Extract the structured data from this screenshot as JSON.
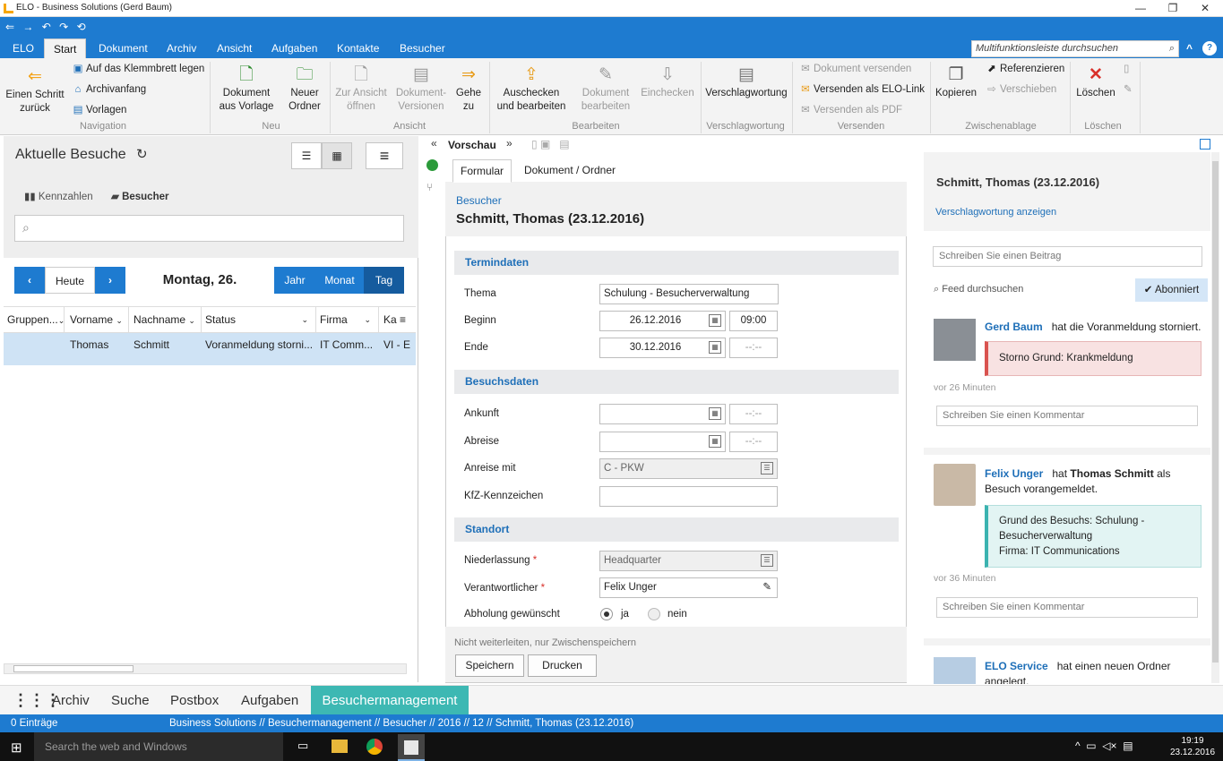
{
  "window": {
    "title": "ELO - Business Solutions (Gerd Baum)",
    "minimize": "—",
    "restore": "❐",
    "close": "✕"
  },
  "quickaccess": [
    "⇐",
    "→",
    "↶",
    "↷",
    "⟲"
  ],
  "menu": {
    "tabs": [
      "ELO",
      "Start",
      "Dokument",
      "Archiv",
      "Ansicht",
      "Aufgaben",
      "Kontakte",
      "Besucher"
    ],
    "active": "Start",
    "search_placeholder": "Multifunktionsleiste durchsuchen",
    "up": "^",
    "help": "?"
  },
  "ribbon": {
    "nav_back": "Einen Schritt zurück",
    "nav_back_l1": "Einen Schritt",
    "nav_back_l2": "zurück",
    "clipboard": "Auf das Klemmbrett legen",
    "archive_start": "Archivanfang",
    "templates": "Vorlagen",
    "group_nav": "Navigation",
    "doc_from_template_l1": "Dokument",
    "doc_from_template_l2": "aus Vorlage",
    "new_folder_l1": "Neuer",
    "new_folder_l2": "Ordner",
    "group_new": "Neu",
    "open_view_l1": "Zur Ansicht",
    "open_view_l2": "öffnen",
    "doc_versions_l1": "Dokument-",
    "doc_versions_l2": "Versionen",
    "goto_l1": "Gehe",
    "goto_l2": "zu",
    "group_view": "Ansicht",
    "checkout_l1": "Auschecken",
    "checkout_l2": "und bearbeiten",
    "edit_doc_l1": "Dokument",
    "edit_doc_l2": "bearbeiten",
    "checkin": "Einchecken",
    "group_edit": "Bearbeiten",
    "keywording": "Verschlagwortung",
    "group_keywording": "Verschlagwortung",
    "send_doc": "Dokument versenden",
    "send_elo_link": "Versenden als ELO-Link",
    "send_pdf": "Versenden als PDF",
    "group_send": "Versenden",
    "copy": "Kopieren",
    "reference": "Referenzieren",
    "move": "Verschieben",
    "group_clipboard": "Zwischenablage",
    "delete": "Löschen",
    "group_delete": "Löschen"
  },
  "left": {
    "title": "Aktuelle Besuche",
    "kpi": "Kennzahlen",
    "visitors": "Besucher",
    "search_placeholder": "",
    "today": "Heute",
    "date": "Montag, 26.",
    "views": [
      "Jahr",
      "Monat",
      "Tag"
    ],
    "active_view": "Tag",
    "columns": [
      "Gruppen...",
      "Vorname",
      "Nachname",
      "Status",
      "Firma",
      "Ka"
    ],
    "rows": [
      {
        "vorname": "Thomas",
        "nachname": "Schmitt",
        "status": "Voranmeldung storni...",
        "firma": "IT Comm...",
        "ka": "VI - E"
      }
    ]
  },
  "center": {
    "preview": "Vorschau",
    "tabs": [
      "Formular",
      "Dokument / Ordner"
    ],
    "form_type": "Besucher",
    "form_title": "Schmitt, Thomas (23.12.2016)",
    "sec_termin": "Termindaten",
    "thema_label": "Thema",
    "thema": "Schulung - Besucherverwaltung",
    "beginn_label": "Beginn",
    "beginn_date": "26.12.2016",
    "beginn_time": "09:00",
    "ende_label": "Ende",
    "ende_date": "30.12.2016",
    "ende_time": "--:--",
    "sec_besuch": "Besuchsdaten",
    "ankunft_label": "Ankunft",
    "ankunft_time": "--:--",
    "abreise_label": "Abreise",
    "abreise_time": "--:--",
    "anreise_label": "Anreise mit",
    "anreise": "C - PKW",
    "kfz_label": "KfZ-Kennzeichen",
    "sec_standort": "Standort",
    "niederlassung_label": "Niederlassung",
    "niederlassung": "Headquarter",
    "verantwortlich_label": "Verantwortlicher",
    "verantwortlich": "Felix Unger",
    "abholung_label": "Abholung gewünscht",
    "ja": "ja",
    "nein": "nein",
    "note": "Nicht weiterleiten, nur Zwischenspeichern",
    "save": "Speichern",
    "print": "Drucken"
  },
  "right": {
    "title": "Schmitt, Thomas (23.12.2016)",
    "show_kw": "Verschlagwortung anzeigen",
    "write_post": "Schreiben Sie einen Beitrag",
    "search_feed": "Feed durchsuchen",
    "subscribed": "Abonniert",
    "comment_placeholder": "Schreiben Sie einen Kommentar",
    "posts": [
      {
        "user": "Gerd Baum",
        "action": "hat die Voranmeldung storniert.",
        "box": "Storno Grund: Krankmeldung",
        "time": "vor 26 Minuten"
      },
      {
        "user": "Felix Unger",
        "action_pre": "hat",
        "action_bold": "Thomas Schmitt",
        "action_post": "als Besuch vorangemeldet.",
        "box1": "Grund des Besuchs: Schulung -",
        "box2": "Besucherverwaltung",
        "box3": "Firma: IT Communications",
        "time": "vor 36 Minuten"
      },
      {
        "user": "ELO Service",
        "action": "hat einen neuen Ordner angelegt."
      }
    ]
  },
  "bottom": {
    "tabs": [
      "Archiv",
      "Suche",
      "Postbox",
      "Aufgaben",
      "Besuchermanagement"
    ],
    "active": "Besuchermanagement"
  },
  "status": {
    "count": "0 Einträge",
    "path": "Business Solutions // Besuchermanagement // Besucher // 2016 // 12 // Schmitt, Thomas (23.12.2016)"
  },
  "taskbar": {
    "search": "Search the web and Windows",
    "time": "19:19",
    "date": "23.12.2016"
  },
  "colors": {
    "accent": "#1e7bd0",
    "link": "#1e6fb8",
    "red": "#d9534f",
    "teal": "#3bb3b0"
  }
}
